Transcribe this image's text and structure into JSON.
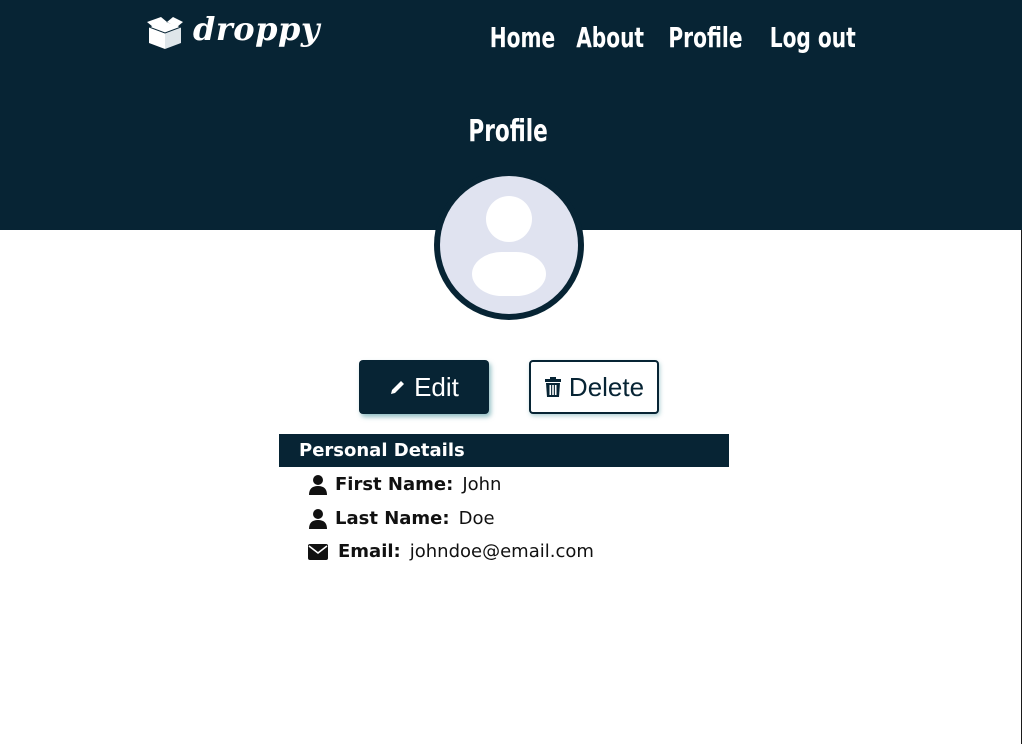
{
  "brand": {
    "name": "droppy",
    "logo_icon": "box-icon"
  },
  "nav": {
    "items": [
      "Home",
      "About",
      "Profile",
      "Log out"
    ]
  },
  "page": {
    "title": "Profile"
  },
  "avatar": {
    "icon": "user-placeholder-icon"
  },
  "actions": {
    "edit_label": "Edit",
    "edit_icon": "pencil-icon",
    "delete_label": "Delete",
    "delete_icon": "trash-icon"
  },
  "details": {
    "title": "Personal Details",
    "rows": [
      {
        "icon": "user-icon",
        "label": "First Name:",
        "value": "John"
      },
      {
        "icon": "user-icon",
        "label": "Last Name:",
        "value": "Doe"
      },
      {
        "icon": "envelope-icon",
        "label": "Email:",
        "value": "johndoe@email.com"
      }
    ]
  },
  "colors": {
    "primary": "#072434",
    "avatar_bg": "#e0e3f0",
    "text": "#111111",
    "background": "#ffffff"
  }
}
